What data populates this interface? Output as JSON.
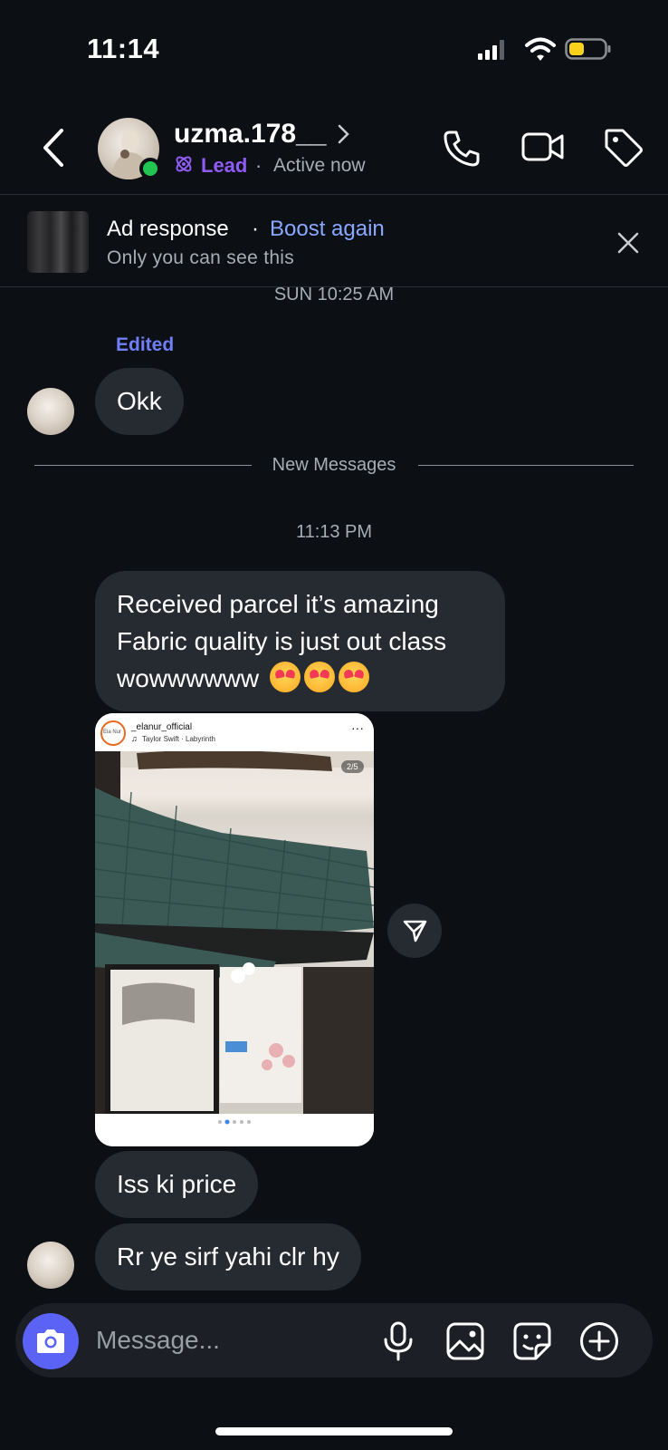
{
  "status_bar": {
    "time": "11:14",
    "icons": [
      "signal-icon",
      "wifi-icon",
      "battery-icon"
    ],
    "battery_color": "#f7d11c"
  },
  "header": {
    "username": "uzma.178__",
    "lead_label": "Lead",
    "separator": "·",
    "status": "Active now",
    "lead_color": "#8e5cf5",
    "online_color": "#23c552",
    "icons": [
      "back-icon",
      "phone-icon",
      "video-camera-icon",
      "tag-icon"
    ]
  },
  "ad_banner": {
    "title": "Ad response",
    "separator": "·",
    "action": "Boost again",
    "subtitle": "Only you can see this",
    "action_color": "#8aa8ff"
  },
  "conversation": {
    "timestamp_1": "SUN 10:25 AM",
    "edited_label": "Edited",
    "msg_okk": "Okk",
    "new_messages_label": "New Messages",
    "timestamp_2": "11:13 PM",
    "msg_received": "Received parcel it’s amazing Fabric quality is just out class wowwwwww",
    "msg_received_emoji": [
      "heart-eyes-emoji",
      "heart-eyes-emoji",
      "heart-eyes-emoji"
    ],
    "shared_post": {
      "account": "_elanur_official",
      "avatar_text": "Ela Nur",
      "song": "Taylor Swift · Labyrinth",
      "counter": "2/5",
      "more": "···"
    },
    "msg_price": "Iss ki price",
    "msg_color": "Rr ye sirf yahi clr hy"
  },
  "composer": {
    "placeholder": "Message...",
    "camera_color": "#5a63f6",
    "icons": [
      "camera-icon",
      "microphone-icon",
      "gallery-icon",
      "sticker-icon",
      "plus-icon"
    ]
  }
}
